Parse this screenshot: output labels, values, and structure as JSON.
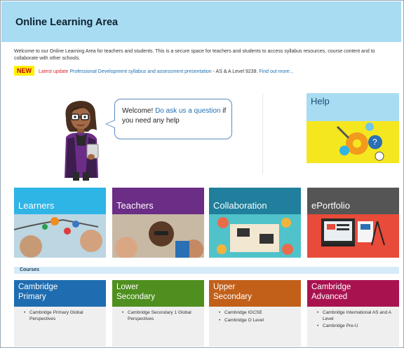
{
  "header": {
    "title": "Online Learning Area"
  },
  "intro": {
    "text": "Welcome to our Online Learning Area for teachers and students. This is a secure space for teachers and students to access syllabus resources, course content and to collaborate with other schools."
  },
  "news": {
    "badge": "NEW",
    "latest_label": "Latest update",
    "link_text": "Professional Development syllabus and assessment presentation",
    "detail": "- AS & A Level 9239.",
    "find_more": "Find out more..."
  },
  "welcome": {
    "greeting": "Welcome!",
    "link": "Do ask us a question",
    "suffix": "if you need any help"
  },
  "help": {
    "title": "Help"
  },
  "tiles": [
    {
      "label": "Learners",
      "color": "#2fb4e6"
    },
    {
      "label": "Teachers",
      "color": "#6b2d86"
    },
    {
      "label": "Collaboration",
      "color": "#1f7f9c"
    },
    {
      "label": "ePortfolio",
      "color": "#555555"
    }
  ],
  "courses_heading": "Courses",
  "courses": [
    {
      "title1": "Cambridge",
      "title2": "Primary",
      "color": "#1f6db0",
      "items": [
        "Cambridge Primary Global Perspectives"
      ]
    },
    {
      "title1": "Lower",
      "title2": "Secondary",
      "color": "#4f8f1f",
      "items": [
        "Cambridge Secondary 1 Global Perspectives"
      ]
    },
    {
      "title1": "Upper",
      "title2": "Secondary",
      "color": "#c2601a",
      "items": [
        "Cambridge IGCSE",
        "Cambridge O Level"
      ]
    },
    {
      "title1": "Cambridge",
      "title2": "Advanced",
      "color": "#a8134f",
      "items": [
        "Cambridge International AS and A Level",
        "Cambridge Pre-U"
      ]
    }
  ]
}
